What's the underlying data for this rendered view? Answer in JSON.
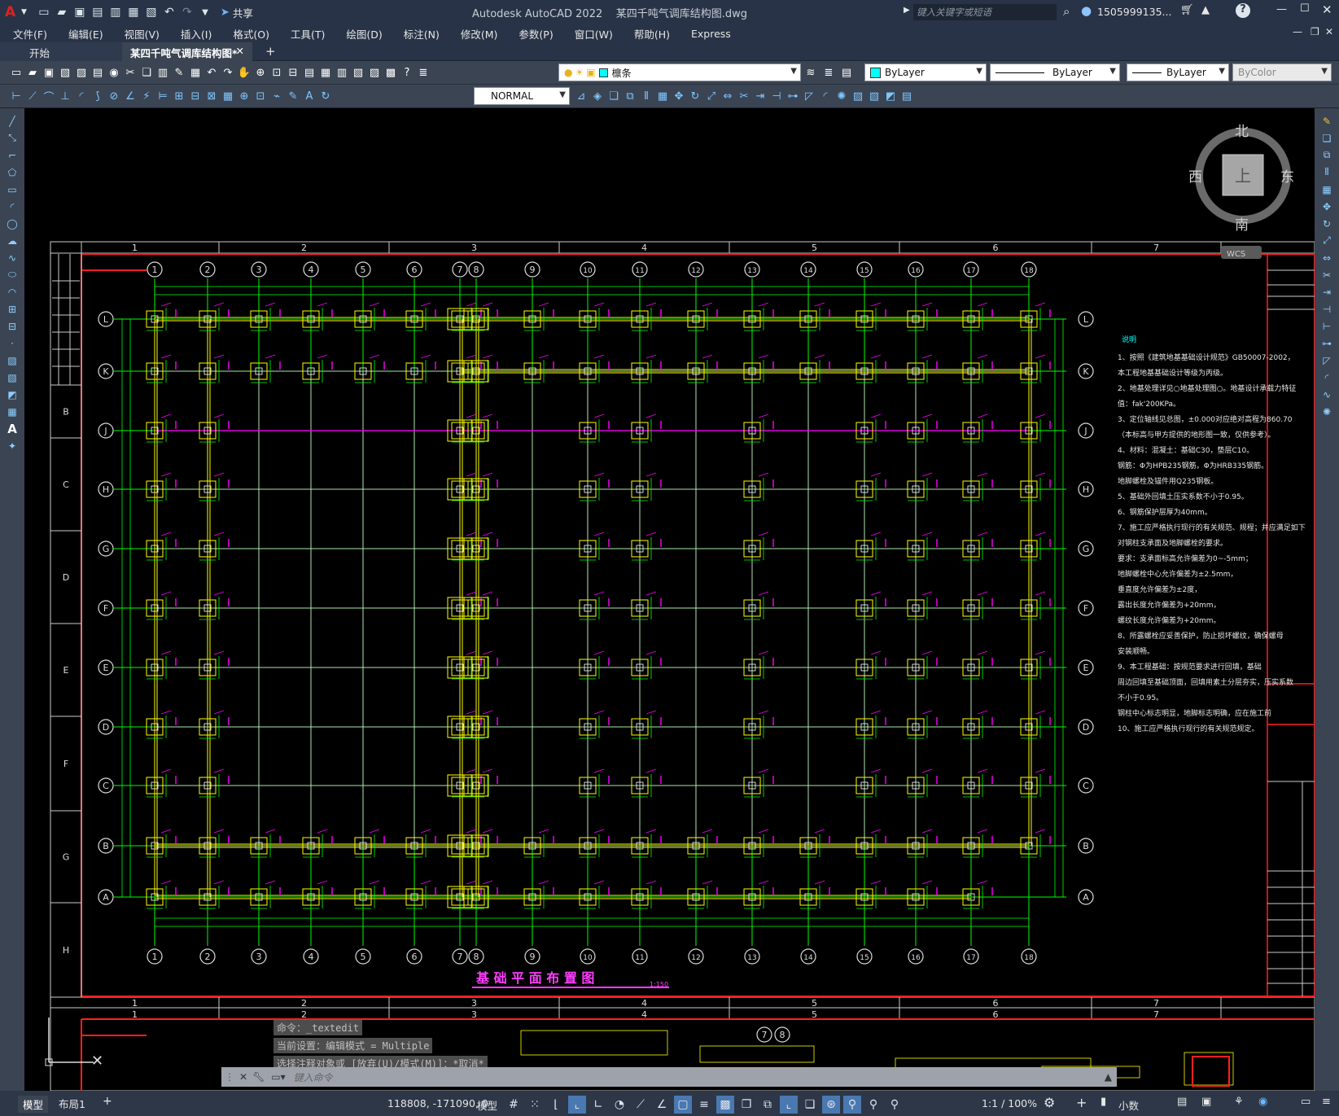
{
  "titlebar": {
    "logo": "A",
    "share": "共享",
    "title": "Autodesk AutoCAD 2022    某四千吨气调库结构图.dwg",
    "search_placeholder": "键入关键字或短语",
    "user": "1505999135..."
  },
  "menu": [
    "文件(F)",
    "编辑(E)",
    "视图(V)",
    "插入(I)",
    "格式(O)",
    "工具(T)",
    "绘图(D)",
    "标注(N)",
    "修改(M)",
    "参数(P)",
    "窗口(W)",
    "帮助(H)",
    "Express"
  ],
  "tabs": {
    "start": "开始",
    "active": "某四千吨气调库结构图*",
    "add": "+"
  },
  "toolbar": {
    "layer": "檩条",
    "color": "ByLayer",
    "linetype": "ByLayer",
    "lineweight": "ByLayer",
    "plotstyle": "ByColor",
    "dimstyle": "NORMAL"
  },
  "viewcube": {
    "north": "北",
    "south": "南",
    "east": "东",
    "west": "西",
    "top": "上",
    "wcs": "WCS"
  },
  "drawing": {
    "title": "基 础 平 面 布 置 图",
    "scale": "1:150",
    "col_labels": [
      "1",
      "2",
      "3",
      "4",
      "5",
      "6",
      "7",
      "8",
      "9",
      "10",
      "11",
      "12",
      "13",
      "14",
      "15",
      "16",
      "17",
      "18"
    ],
    "row_labels": [
      "L",
      "K",
      "J",
      "H",
      "G",
      "F",
      "E",
      "D",
      "C",
      "B",
      "A"
    ],
    "frame_top": [
      "1",
      "2",
      "3",
      "4",
      "5",
      "6",
      "7"
    ],
    "frame_left": [
      "B",
      "C",
      "D",
      "E",
      "F",
      "G",
      "H"
    ],
    "notes_title": "说明",
    "notes": [
      "1、按照《建筑地基基础设计规范》GB50007-2002，",
      "本工程地基基础设计等级为丙级。",
      "2、地基处理详见○地基处理图○。地基设计承载力特征",
      "值：fak'200KPa。",
      "3、定位轴线见总图，±0.000对应绝对高程为860.70",
      "（本标高与甲方提供的地形图一致，仅供参考）。",
      "4、材料：混凝土：基础C30，垫层C10。",
      "钢筋：Φ为HPB235钢筋，Φ为HRB335钢筋。",
      "地脚螺栓及锚件用Q235钢板。",
      "5、基础外回填土压实系数不小于0.95。",
      "6、钢筋保护层厚为40mm。",
      "7、施工应严格执行现行的有关规范、规程；并应满足如下",
      "对钢柱支承面及地脚螺栓的要求。",
      "要求：支承面标高允许偏差为0~-5mm；",
      "地脚螺栓中心允许偏差为±2.5mm，",
      "垂直度允许偏差为±2度，",
      "露出长度允许偏差为+20mm，",
      "螺纹长度允许偏差为+20mm。",
      "8、所露螺栓应妥善保护，防止损坏螺纹，确保螺母",
      "安装顺畅。",
      "9、本工程基础：按规范要求进行回填，基础",
      "周边回填至基础顶面，回填用素土分层夯实，压实系数",
      "不小于0.95。",
      "钢柱中心标志明显，地脚标志明确，应在施工前",
      "10、施工应严格执行现行的有关规范规定。"
    ]
  },
  "command": {
    "lines": [
      "命令：_textedit",
      "当前设置：编辑模式 = Multiple",
      "选择注释对象或 [放弃(U)/模式(M)]：*取消*"
    ],
    "placeholder": "键入命令"
  },
  "status": {
    "model_tab": "模型",
    "layout_tab": "布局1",
    "add": "+",
    "coords": "118808, -171090, 0",
    "model": "模型",
    "scale": "1:1 / 100%",
    "units": "小数"
  }
}
